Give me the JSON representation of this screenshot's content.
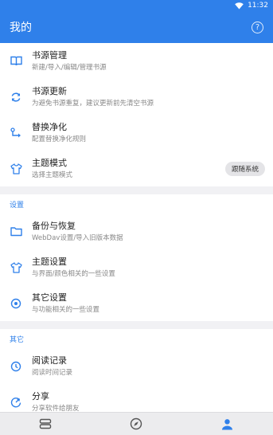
{
  "status": {
    "time": "11:32"
  },
  "appbar": {
    "title": "我的",
    "help_glyph": "?"
  },
  "card1": [
    {
      "icon": "book-icon",
      "title": "书源管理",
      "subtitle": "新建/导入/编辑/管理书源"
    },
    {
      "icon": "refresh-icon",
      "title": "书源更新",
      "subtitle": "为避免书源重复，建议更新前先清空书源"
    },
    {
      "icon": "replace-icon",
      "title": "替换净化",
      "subtitle": "配置替换净化规则"
    },
    {
      "icon": "shirt-icon",
      "title": "主题模式",
      "subtitle": "选择主题模式",
      "badge": "跟随系统"
    }
  ],
  "settings": {
    "header": "设置",
    "items": [
      {
        "icon": "folder-icon",
        "title": "备份与恢复",
        "subtitle": "WebDav设置/导入旧版本数据"
      },
      {
        "icon": "shirt-icon",
        "title": "主题设置",
        "subtitle": "与界面/颜色相关的一些设置"
      },
      {
        "icon": "settings-icon",
        "title": "其它设置",
        "subtitle": "与功能相关的一些设置"
      }
    ]
  },
  "other": {
    "header": "其它",
    "items": [
      {
        "icon": "history-icon",
        "title": "阅读记录",
        "subtitle": "阅读时间记录"
      },
      {
        "icon": "share-icon",
        "title": "分享",
        "subtitle": "分享软件给朋友"
      }
    ]
  },
  "bottom_nav": [
    {
      "icon": "bookshelf-icon",
      "active": false
    },
    {
      "icon": "compass-icon",
      "active": false
    },
    {
      "icon": "person-icon",
      "active": true
    }
  ],
  "colors": {
    "accent": "#2f80ea",
    "icon": "#2f80ea",
    "background": "#f1f1f4"
  }
}
